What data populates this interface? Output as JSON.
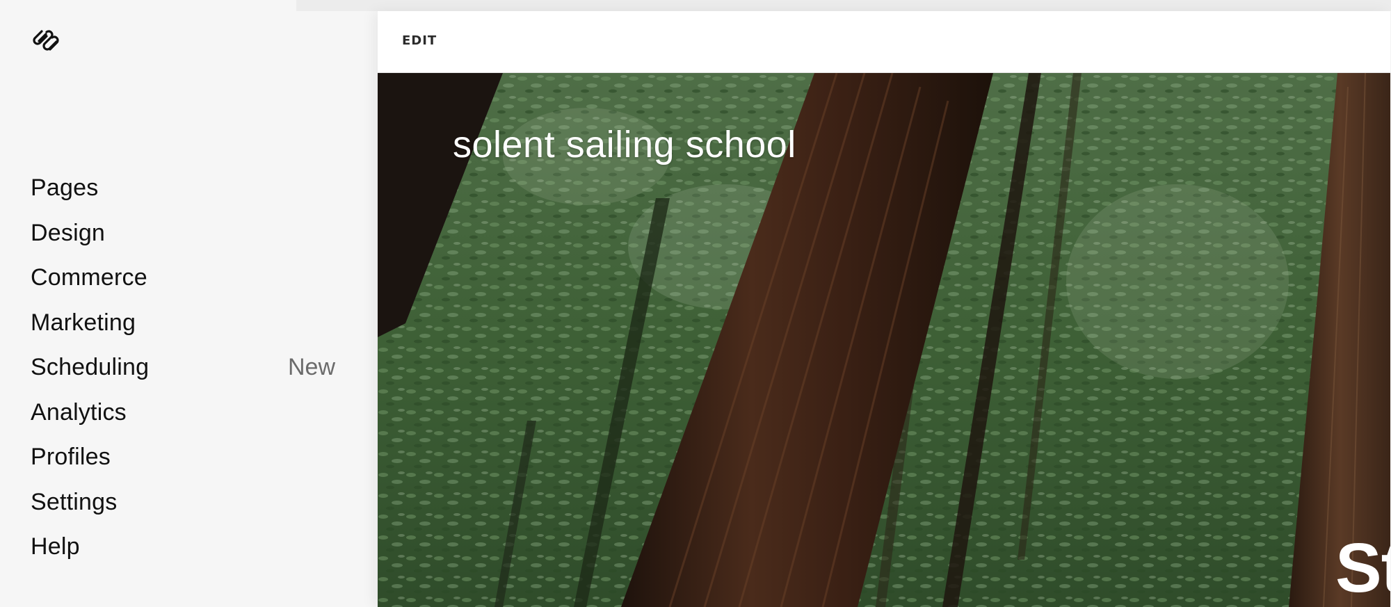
{
  "sidebar": {
    "logo_icon": "squarespace-logo-icon",
    "items": [
      {
        "label": "Pages",
        "badge": null
      },
      {
        "label": "Design",
        "badge": null
      },
      {
        "label": "Commerce",
        "badge": null
      },
      {
        "label": "Marketing",
        "badge": null
      },
      {
        "label": "Scheduling",
        "badge": "New"
      },
      {
        "label": "Analytics",
        "badge": null
      },
      {
        "label": "Profiles",
        "badge": null
      },
      {
        "label": "Settings",
        "badge": null
      },
      {
        "label": "Help",
        "badge": null
      }
    ]
  },
  "preview": {
    "edit_label": "EDIT",
    "site_title": "solent sailing school",
    "hero_heading_visible": "St",
    "hero_image": "forest-redwood-trees-image"
  },
  "colors": {
    "sidebar_bg": "#f6f6f6",
    "nav_text": "#111111",
    "badge_text": "#6b6b6b",
    "header_bg": "#ffffff",
    "hero_text": "#ffffff"
  }
}
